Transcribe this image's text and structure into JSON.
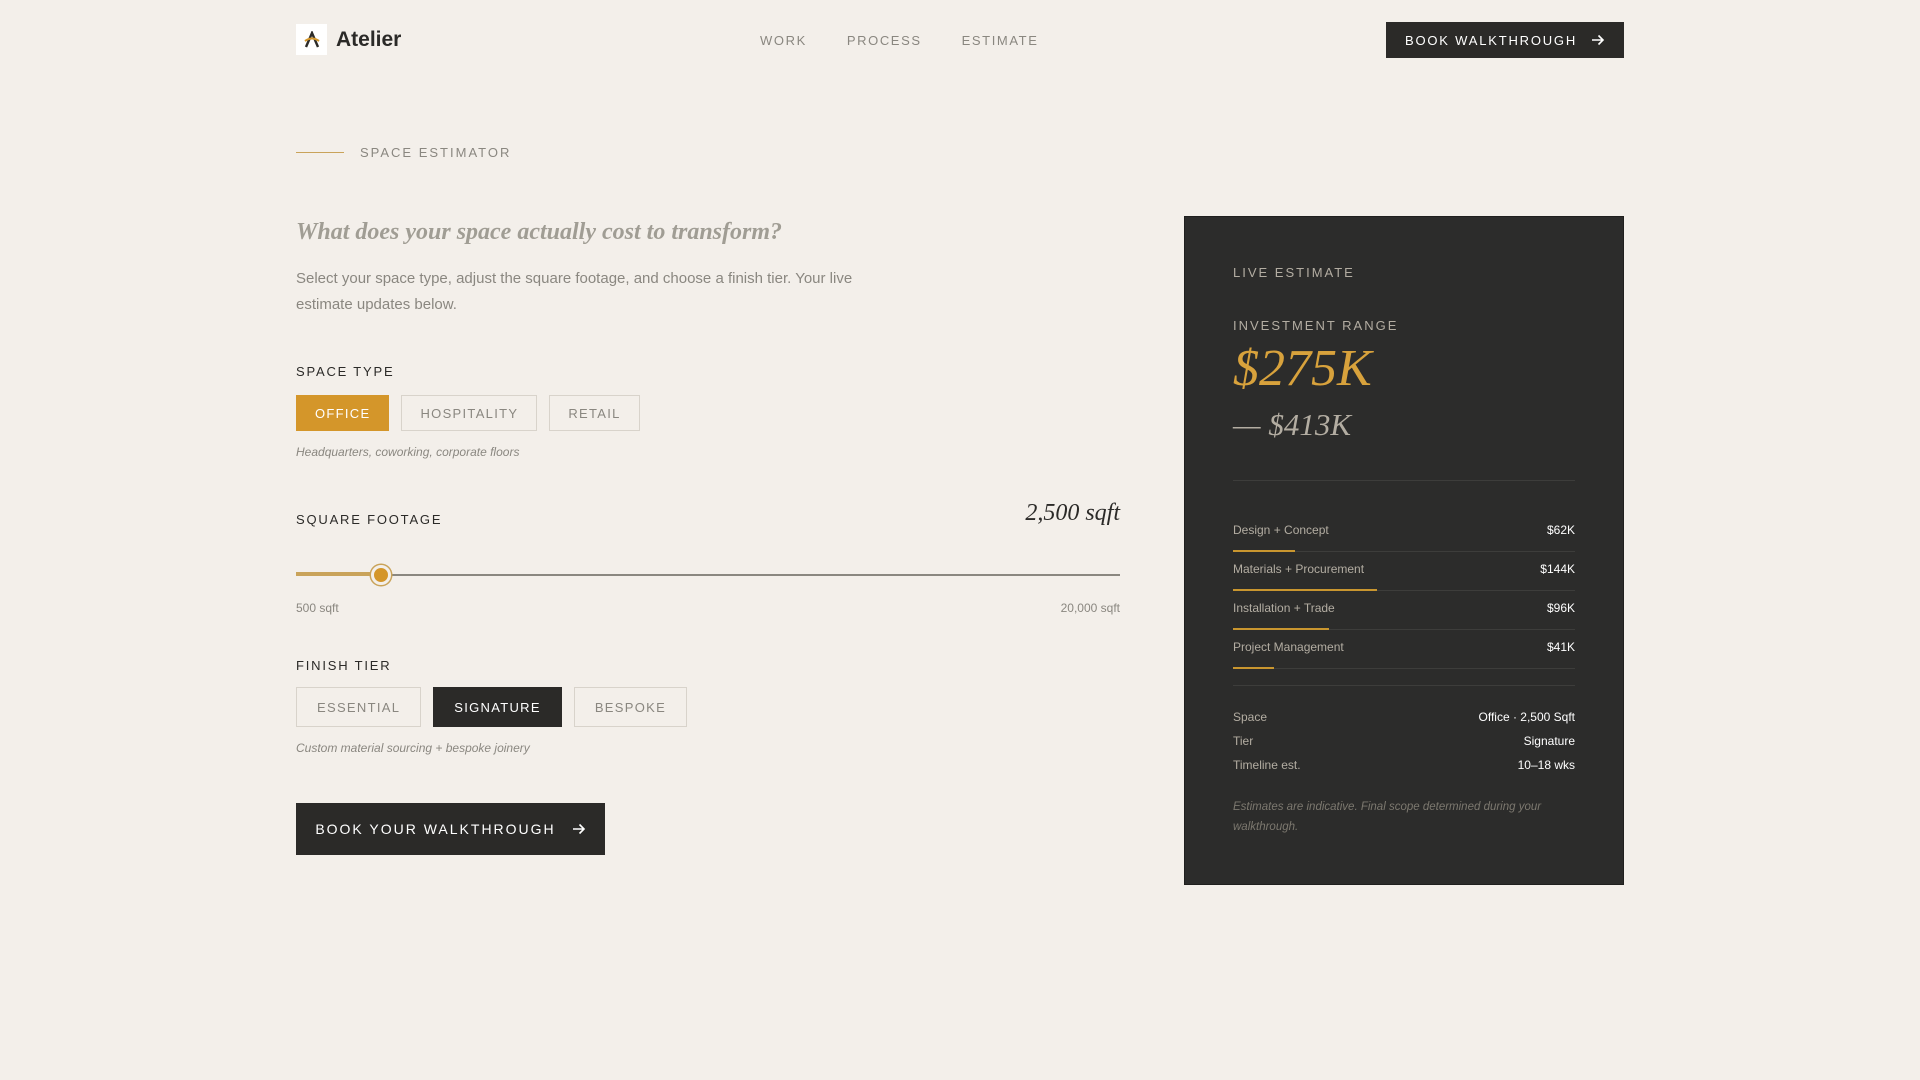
{
  "header": {
    "logo_text": "Atelier",
    "logo_icon": "atelier-logo-icon",
    "nav": [
      "WORK",
      "PROCESS",
      "ESTIMATE"
    ],
    "cta_label": "BOOK WALKTHROUGH"
  },
  "eyebrow": "SPACE ESTIMATOR",
  "headline": "What does your space actually cost to transform?",
  "subtext": "Select your space type, adjust the square footage, and choose a finish tier. Your live estimate updates below.",
  "space_type": {
    "label": "SPACE TYPE",
    "options": [
      "OFFICE",
      "HOSPITALITY",
      "RETAIL"
    ],
    "selected": "OFFICE",
    "hint": "Headquarters, coworking, corporate floors"
  },
  "square_footage": {
    "label": "SQUARE FOOTAGE",
    "value_display": "2,500 sqft",
    "value": 2500,
    "min": 500,
    "max": 20000,
    "min_label": "500 sqft",
    "max_label": "20,000 sqft"
  },
  "finish_tier": {
    "label": "FINISH TIER",
    "options": [
      "ESSENTIAL",
      "SIGNATURE",
      "BESPOKE"
    ],
    "selected": "SIGNATURE",
    "hint": "Custom material sourcing + bespoke joinery"
  },
  "cta_label": "BOOK YOUR WALKTHROUGH",
  "estimate": {
    "title": "LIVE ESTIMATE",
    "range_label": "INVESTMENT RANGE",
    "low": "$275K",
    "high": "— $413K",
    "breakdown": [
      {
        "name": "Design + Concept",
        "value": "$62K",
        "share": 0.18
      },
      {
        "name": "Materials + Procurement",
        "value": "$144K",
        "share": 0.42
      },
      {
        "name": "Installation + Trade",
        "value": "$96K",
        "share": 0.28
      },
      {
        "name": "Project Management",
        "value": "$41K",
        "share": 0.12
      }
    ],
    "meta": [
      {
        "key": "Space",
        "value": "Office · 2,500 Sqft"
      },
      {
        "key": "Tier",
        "value": "Signature"
      },
      {
        "key": "Timeline est.",
        "value": "10–18 wks"
      }
    ],
    "disclaimer": "Estimates are indicative. Final scope determined during your walkthrough."
  },
  "colors": {
    "accent": "#d4962a",
    "dark": "#2b2a28",
    "background": "#f3efea"
  }
}
